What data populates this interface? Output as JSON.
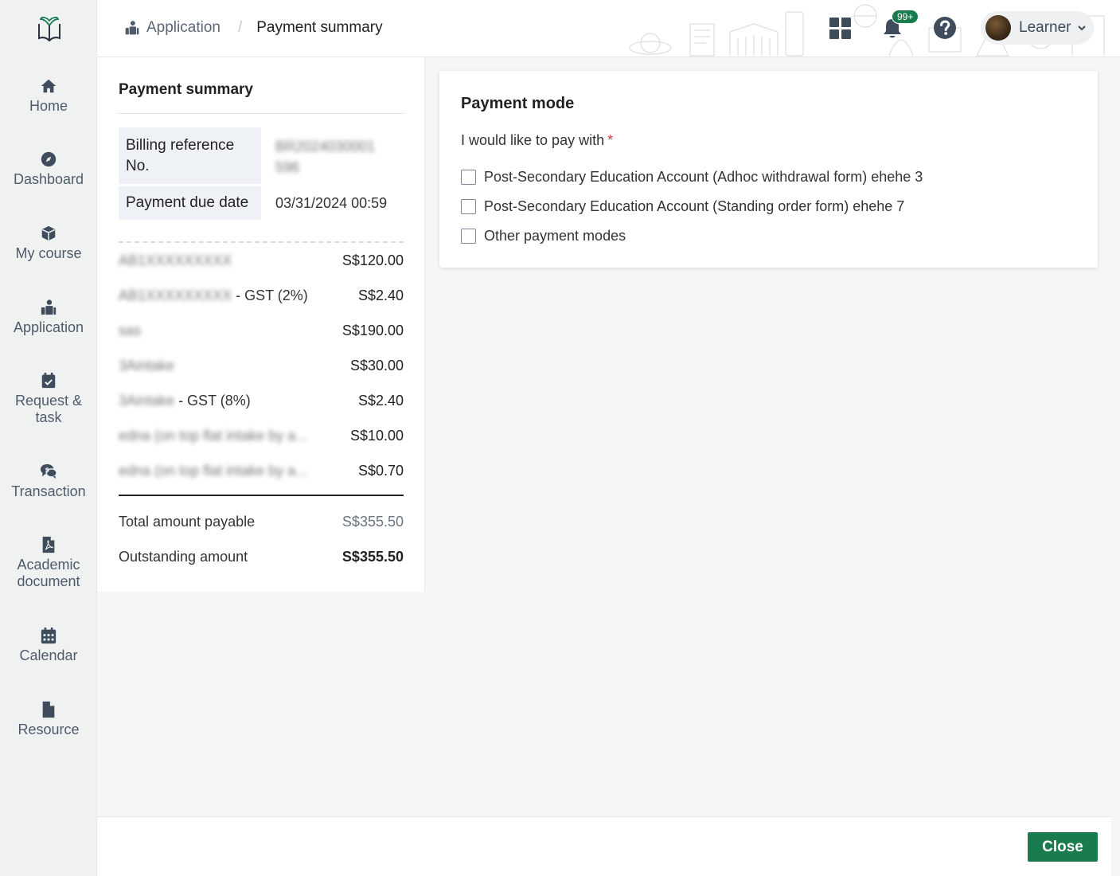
{
  "sidebar": {
    "logo_icon": "open-book-leaf-icon",
    "items": [
      {
        "label": "Home",
        "icon": "home-icon"
      },
      {
        "label": "Dashboard",
        "icon": "compass-icon"
      },
      {
        "label": "My course",
        "icon": "cube-icon"
      },
      {
        "label": "Application",
        "icon": "person-box-icon"
      },
      {
        "label": "Request &",
        "label2": "task",
        "icon": "calendar-check-icon"
      },
      {
        "label": "Transaction",
        "icon": "chat-dollar-icon"
      },
      {
        "label": "Academic",
        "label2": "document",
        "icon": "pdf-file-icon"
      },
      {
        "label": "Calendar",
        "icon": "calendar-grid-icon"
      },
      {
        "label": "Resource",
        "icon": "file-icon"
      }
    ]
  },
  "header": {
    "breadcrumb": {
      "parent": "Application",
      "separator": "/",
      "current": "Payment summary"
    },
    "notification_badge": "99+",
    "user_name": "Learner"
  },
  "summary": {
    "title": "Payment summary",
    "billing_label": "Billing reference No.",
    "billing_label_line1": "Billing reference",
    "billing_label_line2": "No.",
    "billing_value_line1": "BR2024030001",
    "billing_value_line2": "596",
    "due_label": "Payment due date",
    "due_value": "03/31/2024 00:59",
    "line_items": [
      {
        "name": "AB1XXXXXXXXX",
        "suffix": "",
        "amount": "S$120.00"
      },
      {
        "name": "AB1XXXXXXXXX",
        "suffix": " - GST (2%)",
        "amount": "S$2.40"
      },
      {
        "name": "sas",
        "suffix": "",
        "amount": "S$190.00"
      },
      {
        "name": "3Aintake",
        "suffix": "",
        "amount": "S$30.00"
      },
      {
        "name": "3Aintake",
        "suffix": " - GST (8%)",
        "amount": "S$2.40"
      },
      {
        "name": "edna (on top flat intake by a...",
        "suffix": "",
        "amount": "S$10.00"
      },
      {
        "name": "edna (on top flat intake by a...",
        "suffix": "",
        "amount": "S$0.70"
      }
    ],
    "total_label": "Total amount payable",
    "total_value": "S$355.50",
    "outstanding_label": "Outstanding amount",
    "outstanding_value": "S$355.50"
  },
  "payment_mode": {
    "title": "Payment mode",
    "prompt": "I would like to pay with",
    "required_mark": "*",
    "options": [
      "Post-Secondary Education Account (Adhoc withdrawal form) ehehe 3",
      "Post-Secondary Education Account (Standing order form) ehehe 7",
      "Other payment modes"
    ]
  },
  "footer": {
    "close_label": "Close"
  },
  "colors": {
    "primary": "#1a7b4f",
    "required": "#d03a3a",
    "sidebar_bg": "#f0f2f2"
  }
}
